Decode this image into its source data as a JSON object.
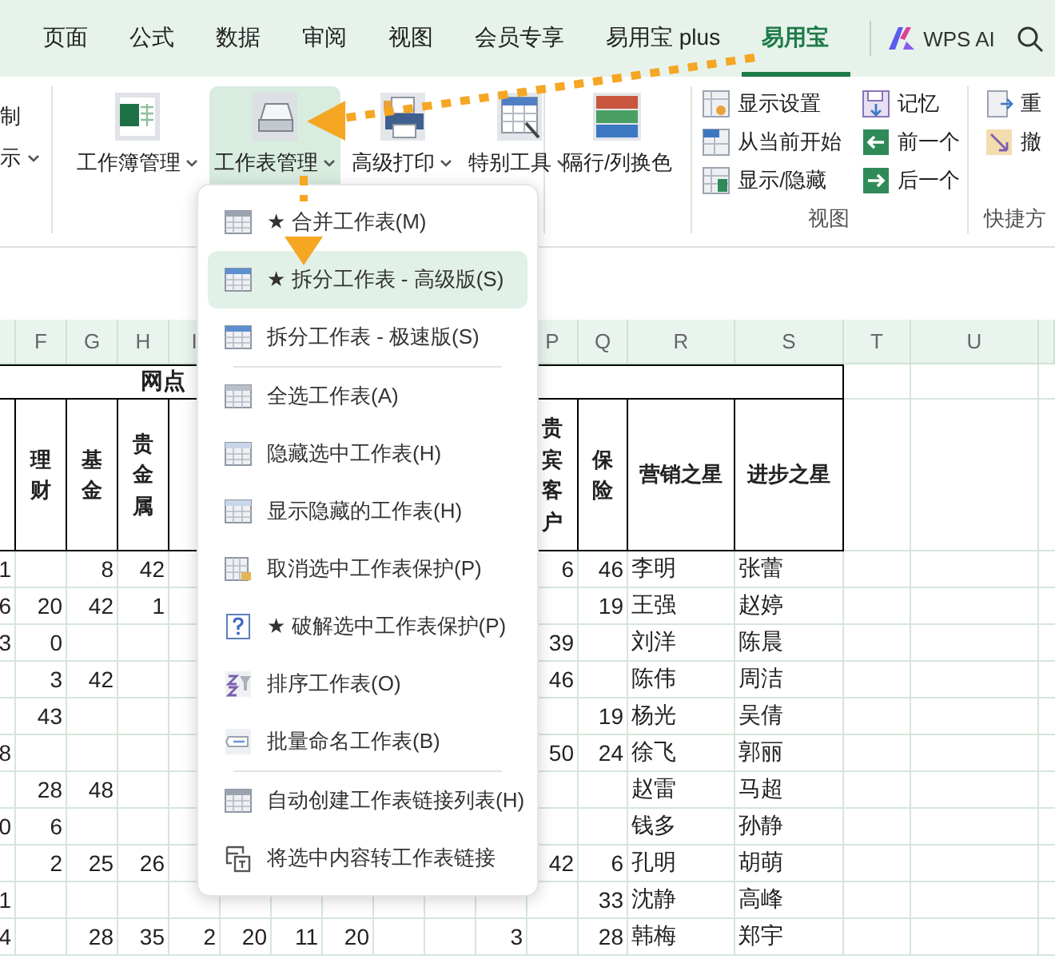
{
  "tabs": [
    {
      "label": "页面",
      "selected": false
    },
    {
      "label": "公式",
      "selected": false
    },
    {
      "label": "数据",
      "selected": false
    },
    {
      "label": "审阅",
      "selected": false
    },
    {
      "label": "视图",
      "selected": false
    },
    {
      "label": "会员专享",
      "selected": false
    },
    {
      "label": "易用宝 plus",
      "selected": false
    },
    {
      "label": "易用宝",
      "selected": true
    }
  ],
  "ai_button": {
    "label": "WPS AI"
  },
  "ribbon": {
    "cut_items": [
      {
        "label": "制",
        "dropdown": false
      },
      {
        "label": "示",
        "dropdown": true
      }
    ],
    "large_buttons": [
      {
        "label": "工作簿管理",
        "selected": false,
        "dropdown": true
      },
      {
        "label": "工作表管理",
        "selected": true,
        "dropdown": true
      },
      {
        "label": "高级打印",
        "selected": false,
        "dropdown": true
      },
      {
        "label": "特别工具",
        "selected": false,
        "dropdown": true
      }
    ],
    "color_button": {
      "label": "隔行/列换色"
    },
    "view_group": {
      "label": "视图",
      "column_1": [
        "显示设置",
        "从当前开始",
        "显示/隐藏"
      ],
      "column_2": [
        "记忆",
        "前一个",
        "后一个"
      ]
    },
    "quick_group": {
      "label": "快捷方",
      "items": [
        "重",
        "撤"
      ]
    }
  },
  "menu": {
    "items": [
      {
        "kind": "item",
        "label": "★ 合并工作表(M)",
        "selected": false
      },
      {
        "kind": "item",
        "label": "★ 拆分工作表 - 高级版(S)",
        "selected": true
      },
      {
        "kind": "item",
        "label": "拆分工作表 - 极速版(S)",
        "selected": false
      },
      {
        "kind": "separator"
      },
      {
        "kind": "item",
        "label": "全选工作表(A)",
        "selected": false
      },
      {
        "kind": "item",
        "label": "隐藏选中工作表(H)",
        "selected": false
      },
      {
        "kind": "item",
        "label": "显示隐藏的工作表(H)",
        "selected": false
      },
      {
        "kind": "item",
        "label": "取消选中工作表保护(P)",
        "selected": false
      },
      {
        "kind": "item",
        "label": "★ 破解选中工作表保护(P)",
        "selected": false
      },
      {
        "kind": "item",
        "label": "排序工作表(O)",
        "selected": false
      },
      {
        "kind": "item",
        "label": "批量命名工作表(B)",
        "selected": false
      },
      {
        "kind": "separator"
      },
      {
        "kind": "item",
        "label": "自动创建工作表链接列表(H)",
        "selected": false
      },
      {
        "kind": "item",
        "label": "将选中内容转工作表链接",
        "selected": false
      }
    ]
  },
  "sheet": {
    "column_letters_left": [
      "F",
      "G",
      "H",
      "I"
    ],
    "column_letters_right": [
      "P",
      "Q",
      "R",
      "S",
      "T",
      "U"
    ],
    "title": "网点",
    "headings": {
      "F": "理财",
      "G": "基金",
      "H": "贵金属",
      "P": "贵宾客户",
      "Q": "保险",
      "R": "营销之星",
      "S": "进步之星"
    },
    "rows": [
      {
        "E": "1",
        "G": "8",
        "H": "42",
        "P": "6",
        "Q": "46",
        "R": "李明",
        "S": "张蕾"
      },
      {
        "E": "6",
        "F": "20",
        "G": "42",
        "H": "1",
        "Q": "19",
        "R": "王强",
        "S": "赵婷"
      },
      {
        "E": "3",
        "F": "0",
        "P": "39",
        "R": "刘洋",
        "S": "陈晨"
      },
      {
        "F": "3",
        "G": "42",
        "P": "46",
        "R": "陈伟",
        "S": "周洁"
      },
      {
        "F": "43",
        "Q": "19",
        "R": "杨光",
        "S": "吴倩"
      },
      {
        "E": "8",
        "P": "50",
        "Q": "24",
        "R": "徐飞",
        "S": "郭丽"
      },
      {
        "F": "28",
        "G": "48",
        "R": "赵雷",
        "S": "马超"
      },
      {
        "E": "0",
        "F": "6",
        "R": "钱多",
        "S": "孙静"
      },
      {
        "F": "2",
        "G": "25",
        "H": "26",
        "P": "42",
        "Q": "6",
        "R": "孔明",
        "S": "胡萌"
      },
      {
        "E": "1",
        "Q": "33",
        "R": "沈静",
        "S": "高峰"
      },
      {
        "E": "4",
        "G": "28",
        "H": "35",
        "I": "2",
        "J": "20",
        "K": "11",
        "L": "20",
        "O": "3",
        "Q": "28",
        "R": "韩梅",
        "S": "郑宇"
      }
    ]
  }
}
